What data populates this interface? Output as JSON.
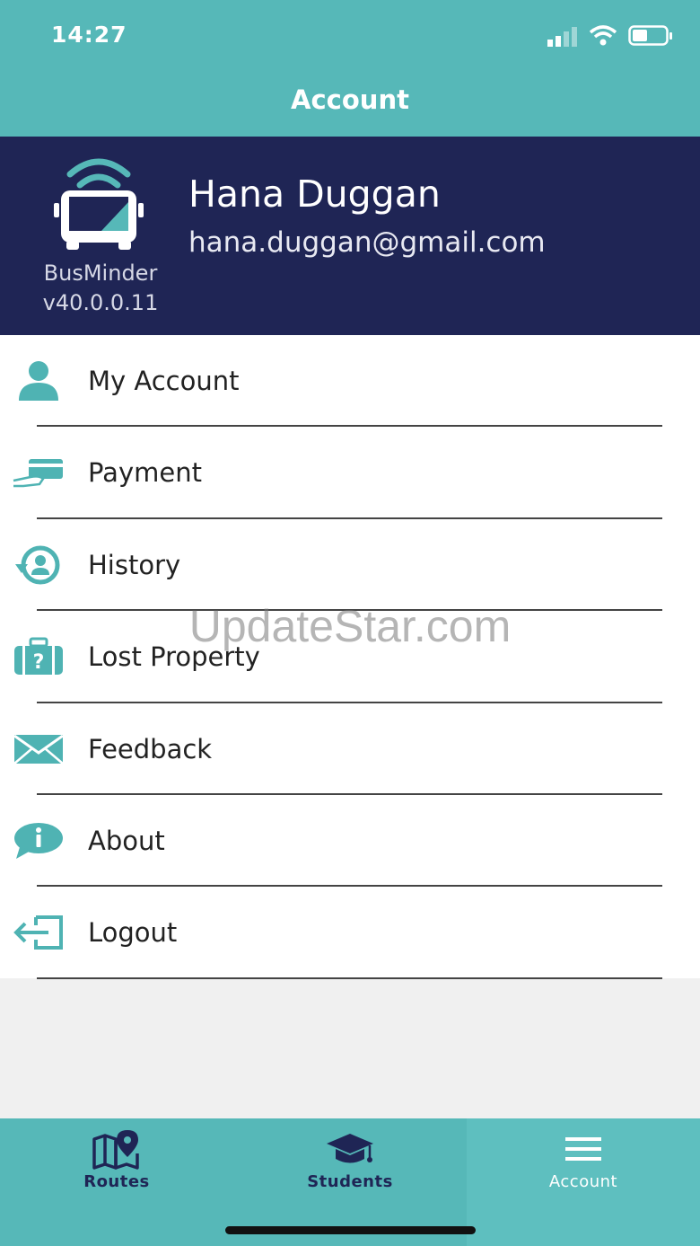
{
  "status_bar": {
    "time": "14:27"
  },
  "header": {
    "title": "Account"
  },
  "profile": {
    "brand": "BusMinder",
    "version": "v40.0.0.11",
    "name": "Hana Duggan",
    "email": "hana.duggan@gmail.com"
  },
  "menu": {
    "items": [
      {
        "label": "My Account",
        "icon": "person-icon"
      },
      {
        "label": "Payment",
        "icon": "credit-card-icon"
      },
      {
        "label": "History",
        "icon": "history-icon"
      },
      {
        "label": "Lost Property",
        "icon": "luggage-icon"
      },
      {
        "label": "Feedback",
        "icon": "envelope-icon"
      },
      {
        "label": "About",
        "icon": "info-icon"
      },
      {
        "label": "Logout",
        "icon": "logout-icon"
      }
    ]
  },
  "watermark": "UpdateStar.com",
  "tabs": [
    {
      "label": "Routes",
      "icon": "map-pin-icon"
    },
    {
      "label": "Students",
      "icon": "graduation-cap-icon"
    },
    {
      "label": "Account",
      "icon": "menu-icon"
    }
  ],
  "colors": {
    "teal": "#56b8b8",
    "navy": "#1f2555",
    "icon_teal": "#4fb3b3"
  }
}
